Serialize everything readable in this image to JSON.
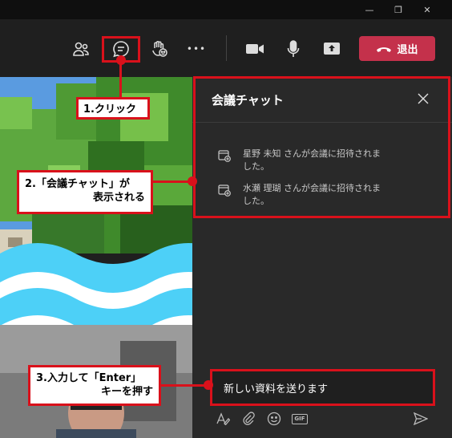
{
  "titlebar": {
    "minimize": "—",
    "restore": "❐",
    "close": "✕"
  },
  "toolbar": {
    "icons": [
      "people-icon",
      "chat-icon",
      "raise-hand-icon",
      "more-icon",
      "camera-icon",
      "mic-icon",
      "share-icon"
    ],
    "more_label": "•••",
    "leave_label": "退出"
  },
  "chat": {
    "title": "会議チャット",
    "messages": [
      {
        "text": "星野 未知 さんが会議に招待されました。"
      },
      {
        "text": "水瀬 理瑚 さんが会議に招待されました。"
      }
    ],
    "compose_value": "新しい資料を送ります",
    "gif_label": "GIF"
  },
  "callouts": {
    "step1": "1.クリック",
    "step2_line1": "2.「会議チャット」が",
    "step2_line2": "表示される",
    "step3_line1": "3.入力して「Enter」",
    "step3_line2": "キーを押す"
  },
  "colors": {
    "accent": "#d9111b",
    "leave": "#c4314b",
    "wave": "#4dd0f7"
  }
}
